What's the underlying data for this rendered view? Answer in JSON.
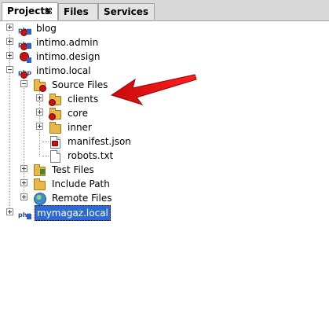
{
  "tabs": [
    {
      "label": "Projects",
      "active": true,
      "close_glyph": "⌘"
    },
    {
      "label": "Files",
      "active": false
    },
    {
      "label": "Services",
      "active": false
    }
  ],
  "tree": {
    "projects": [
      {
        "label": "blog",
        "icon": "php-project-icon",
        "expanded": false
      },
      {
        "label": "intimo.admin",
        "icon": "php-project-icon",
        "expanded": false
      },
      {
        "label": "intimo.design",
        "icon": "php-project-icon",
        "expanded": false
      },
      {
        "label": "intimo.local",
        "icon": "php-project-icon",
        "expanded": true
      },
      {
        "label": "mymagaz.local",
        "icon": "php-project-icon",
        "expanded": false,
        "selected": true
      }
    ],
    "intimo_local_children": [
      {
        "label": "Source Files",
        "icon": "source-folder-icon",
        "expanded": true
      },
      {
        "label": "Test Files",
        "icon": "test-folder-icon",
        "expanded": false
      },
      {
        "label": "Include Path",
        "icon": "folder-icon",
        "expanded": false
      },
      {
        "label": "Remote Files",
        "icon": "globe-icon",
        "expanded": false
      }
    ],
    "source_children": [
      {
        "label": "clients",
        "icon": "folder-icon",
        "expanded": false
      },
      {
        "label": "core",
        "icon": "folder-icon",
        "expanded": false
      },
      {
        "label": "inner",
        "icon": "folder-icon",
        "expanded": false
      },
      {
        "label": "manifest.json",
        "icon": "json-file-icon"
      },
      {
        "label": "robots.txt",
        "icon": "text-file-icon"
      }
    ]
  },
  "annotation": {
    "color": "#e01010"
  },
  "colors": {
    "selection": "#2d6ad6",
    "tabbar": "#d8d8d8"
  }
}
